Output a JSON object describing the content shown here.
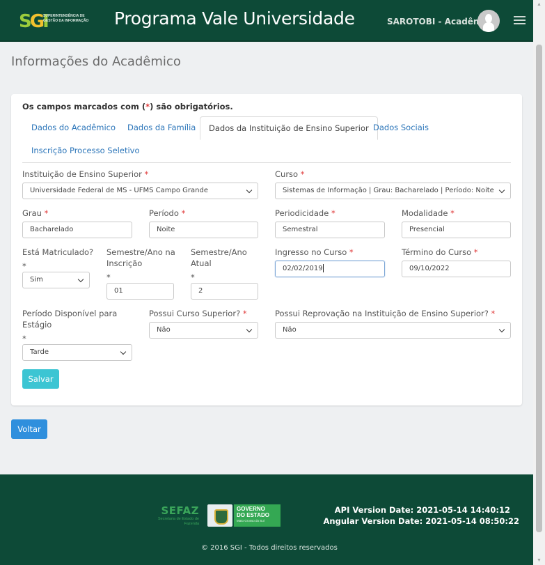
{
  "header": {
    "logo_text": "SGI",
    "logo_subtitle": "SUPERINTENDÊNCIA DE GESTÃO DA INFORMAÇÃO",
    "title": "Programa Vale Universidade",
    "user": "SAROTOBI - Acadêmico",
    "menu_icon": "hamburger-icon",
    "avatar_icon": "user-silhouette-icon"
  },
  "page_title": "Informações do Acadêmico",
  "required_note": {
    "prefix": "Os campos marcados com (",
    "star": "*",
    "suffix": ") são obrigatórios."
  },
  "tabs": [
    {
      "label": "Dados do Acadêmico",
      "active": false
    },
    {
      "label": "Dados da Família",
      "active": false
    },
    {
      "label": "Dados da Instituição de Ensino Superior",
      "active": true
    },
    {
      "label": "Dados Sociais",
      "active": false
    },
    {
      "label": "Inscrição Processo Seletivo",
      "active": false
    }
  ],
  "form": {
    "instituicao": {
      "label": "Instituição de Ensino Superior",
      "value": "Universidade Federal de MS - UFMS Campo Grande"
    },
    "curso": {
      "label": "Curso",
      "value": "Sistemas de Informação | Grau: Bacharelado | Período: Noite"
    },
    "grau": {
      "label": "Grau",
      "value": "Bacharelado"
    },
    "periodo": {
      "label": "Período",
      "value": "Noite"
    },
    "periodicidade": {
      "label": "Periodicidade",
      "value": "Semestral"
    },
    "modalidade": {
      "label": "Modalidade",
      "value": "Presencial"
    },
    "matriculado": {
      "label": "Está Matriculado?",
      "value": "Sim"
    },
    "semestre_inscricao": {
      "label_line1": "Semestre/Ano na",
      "label_line2": "Inscrição",
      "value": "01"
    },
    "semestre_atual": {
      "label_line1": "Semestre/Ano",
      "label_line2": "Atual",
      "value": "2"
    },
    "ingresso": {
      "label": "Ingresso no Curso",
      "value": "02/02/2019"
    },
    "termino": {
      "label": "Término do Curso",
      "value": "09/10/2022"
    },
    "periodo_estagio": {
      "label_line1": "Período Disponível para",
      "label_line2": "Estágio",
      "value": "Tarde"
    },
    "curso_superior": {
      "label": "Possui Curso Superior?",
      "value": "Não"
    },
    "reprovacao": {
      "label": "Possui Reprovação na Instituição de Ensino Superior?",
      "value": "Não"
    },
    "required_star": "*"
  },
  "buttons": {
    "save": "Salvar",
    "back": "Voltar"
  },
  "footer": {
    "sefaz": "SEFAZ",
    "sefaz_sub": "Secretaria de Estado de Fazenda",
    "gov_line1": "GOVERNO",
    "gov_line2": "DO ESTADO",
    "gov_line3": "Mato Grosso do Sul",
    "api_version": "API Version Date: 2021-05-14 14:40:12",
    "angular_version": "Angular Version Date: 2021-05-14 08:50:22",
    "copyright": "© 2016 SGI - Todos direitos reservados"
  },
  "colors": {
    "header_bg": "#0d4a37",
    "link": "#2b75b9",
    "required": "#e03b3b",
    "save_button": "#3cc5d3",
    "back_button": "#2f8fdd"
  }
}
